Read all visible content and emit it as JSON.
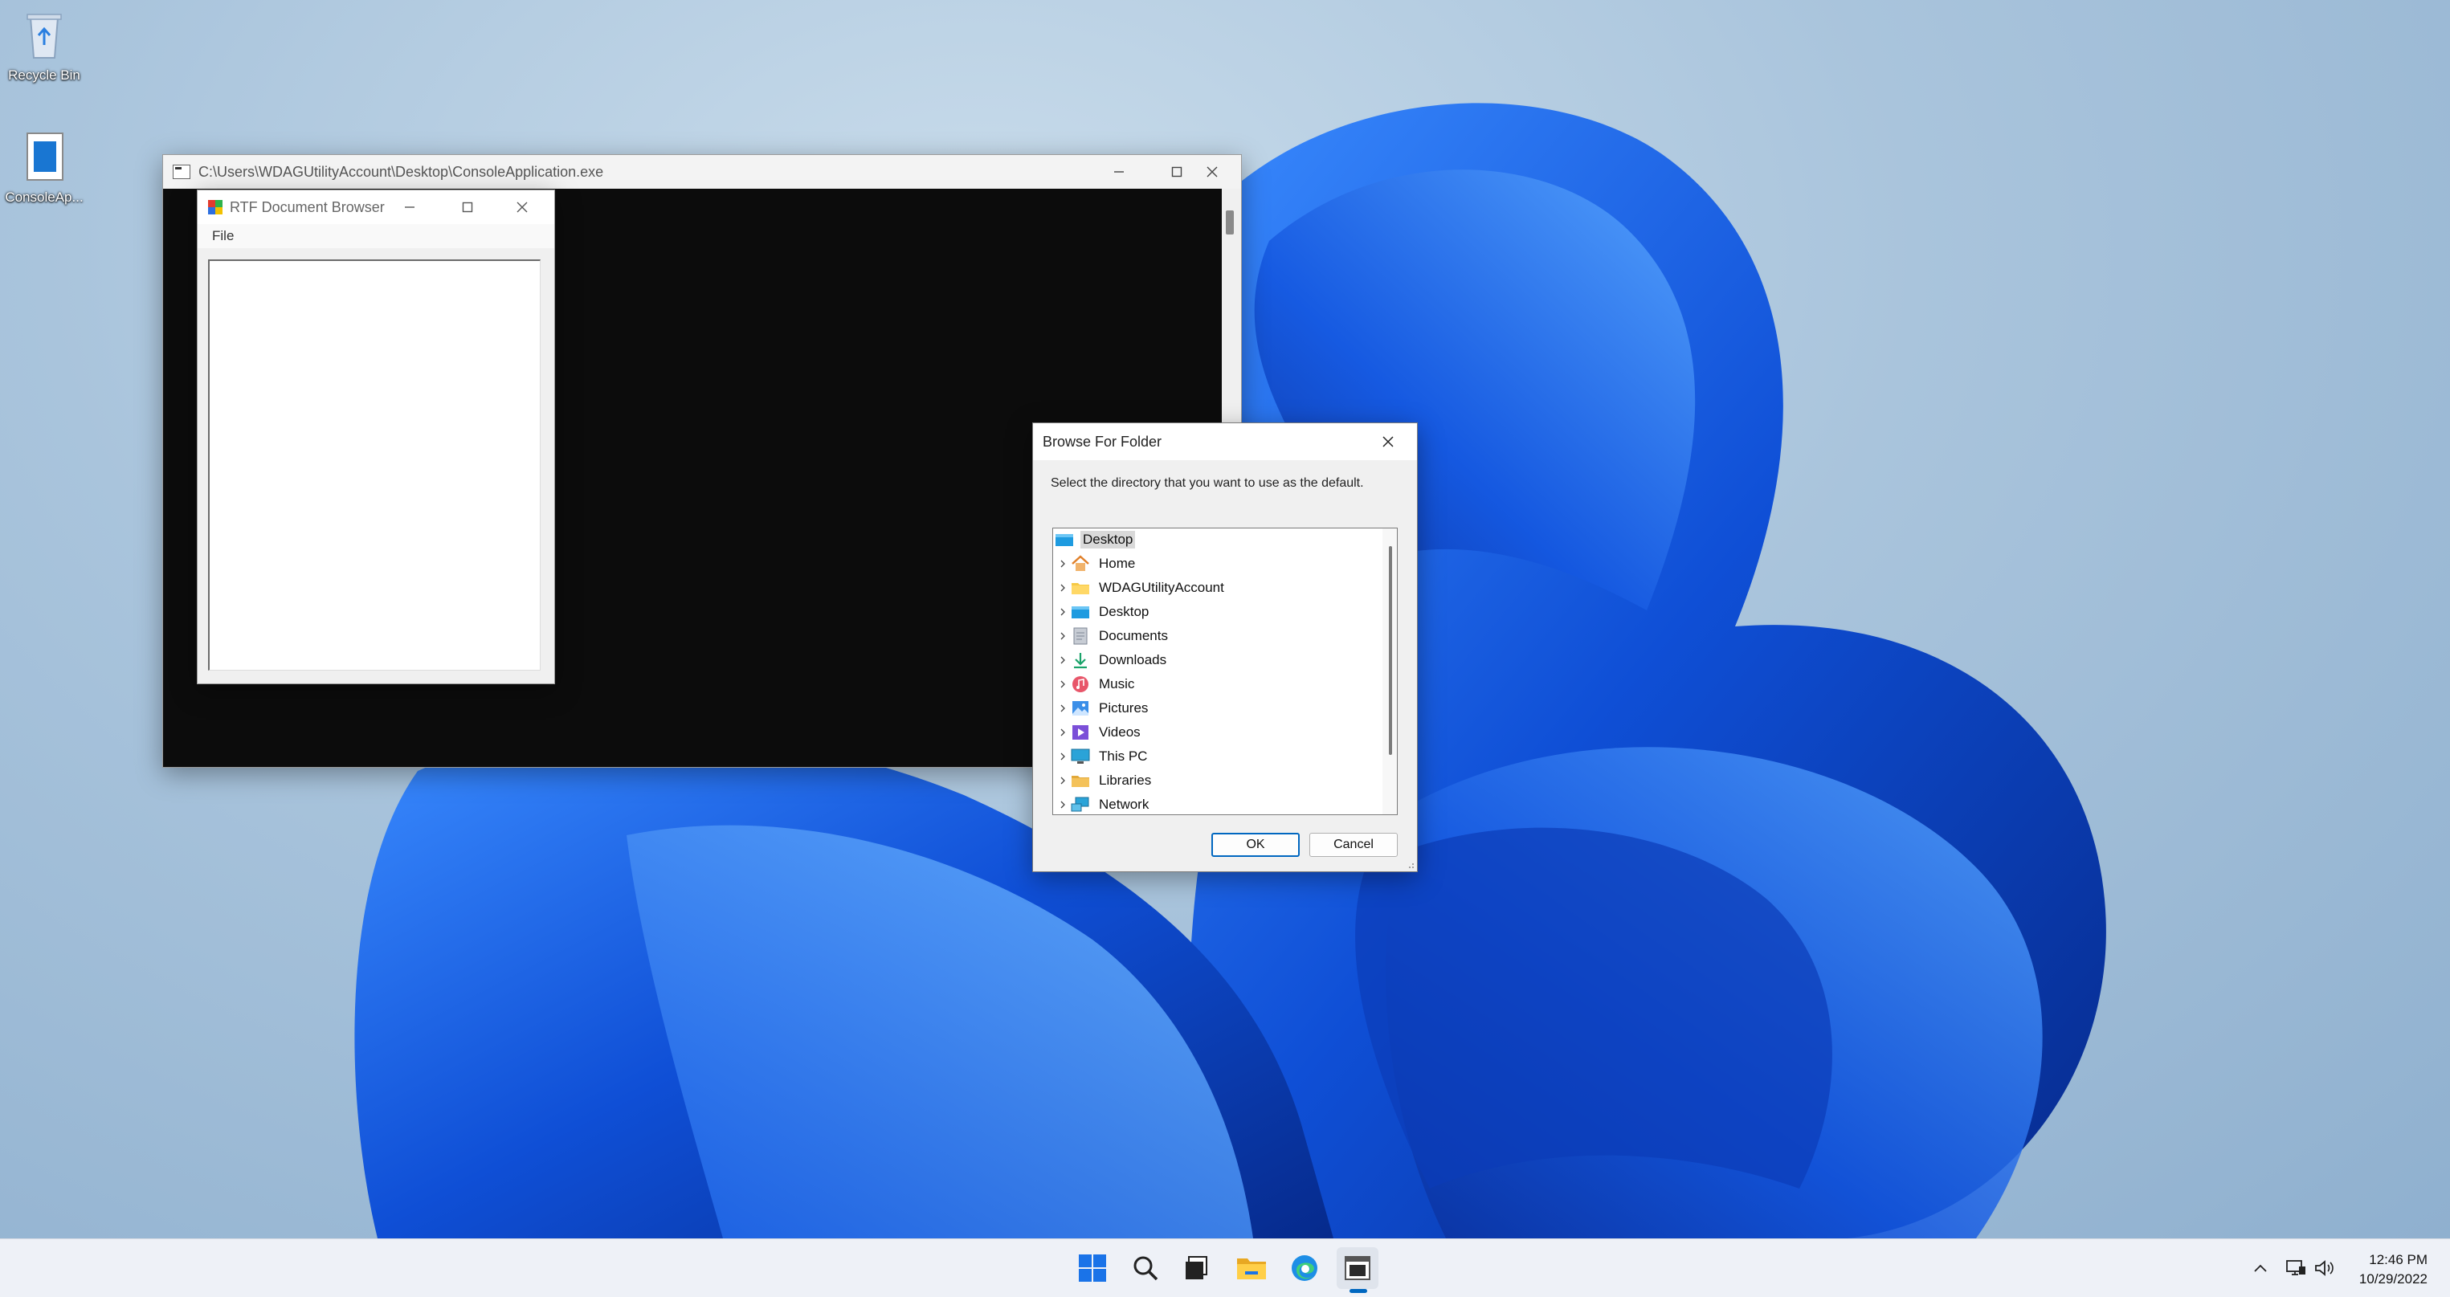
{
  "desktop": {
    "icons": [
      {
        "label": "Recycle Bin",
        "icon": "recycle-bin-icon"
      },
      {
        "label": "ConsoleAp...",
        "icon": "console-app-icon"
      }
    ]
  },
  "console_window": {
    "title": "C:\\Users\\WDAGUtilityAccount\\Desktop\\ConsoleApplication.exe"
  },
  "rtf_window": {
    "title": "RTF Document Browser",
    "menu": {
      "file": "File"
    }
  },
  "browse_dialog": {
    "title": "Browse For Folder",
    "description": "Select the directory that you want to use as the default.",
    "tree": {
      "root": {
        "label": "Desktop",
        "icon": "desktop-folder-icon"
      },
      "items": [
        {
          "label": "Home",
          "icon": "home-icon"
        },
        {
          "label": "WDAGUtilityAccount",
          "icon": "user-folder-icon"
        },
        {
          "label": "Desktop",
          "icon": "desktop-folder-icon"
        },
        {
          "label": "Documents",
          "icon": "documents-icon"
        },
        {
          "label": "Downloads",
          "icon": "downloads-icon"
        },
        {
          "label": "Music",
          "icon": "music-icon"
        },
        {
          "label": "Pictures",
          "icon": "pictures-icon"
        },
        {
          "label": "Videos",
          "icon": "videos-icon"
        },
        {
          "label": "This PC",
          "icon": "this-pc-icon"
        },
        {
          "label": "Libraries",
          "icon": "libraries-icon"
        },
        {
          "label": "Network",
          "icon": "network-icon"
        }
      ]
    },
    "ok_label": "OK",
    "cancel_label": "Cancel"
  },
  "taskbar": {
    "items": [
      "start-icon",
      "search-icon",
      "task-view-icon",
      "file-explorer-icon",
      "edge-icon",
      "console-app-icon"
    ],
    "clock": {
      "time": "12:46 PM",
      "date": "10/29/2022"
    },
    "tray": [
      "chevron-up-icon",
      "network-icon",
      "volume-icon"
    ]
  },
  "colors": {
    "accent": "#0067c0",
    "console_bg": "#0c0c0c",
    "taskbar_bg": "#eef1f7"
  }
}
